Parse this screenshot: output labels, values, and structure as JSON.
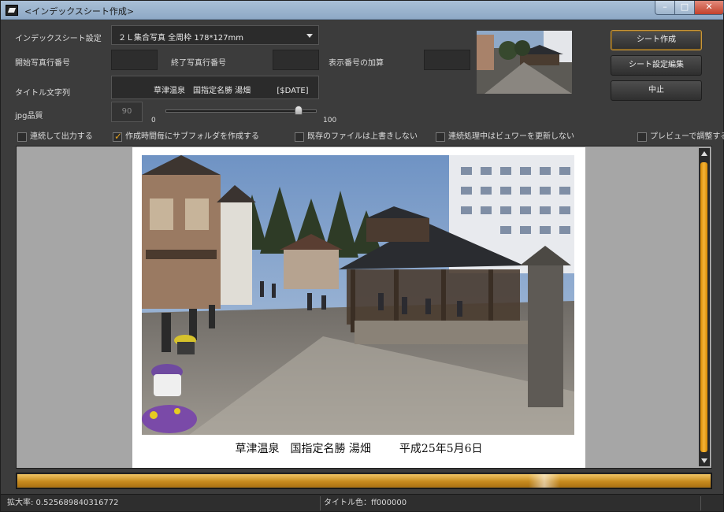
{
  "window": {
    "title": "<インデックスシート作成>",
    "controls": {
      "minimize": "–",
      "maximize": "□",
      "close": "✕"
    }
  },
  "settings": {
    "sheet_setting_label": "インデックスシート設定",
    "sheet_setting_value": "２Ｌ集合写真 全周枠 178*127mm",
    "start_row_label": "開始写真行番号",
    "start_row_value": "",
    "end_row_label": "終了写真行番号",
    "end_row_value": "",
    "display_offset_label": "表示番号の加算",
    "display_offset_value": "",
    "title_label": "タイトル文字列",
    "title_value": "草津温泉　国指定名勝 湯畑　　　 [$DATE]",
    "jpg_quality_label": "jpg品質",
    "jpg_quality_value": "90",
    "slider_min": "0",
    "slider_max": "100",
    "slider_level_percent": 90
  },
  "buttons": {
    "create_sheet": "シート作成",
    "edit_sheet_settings": "シート設定編集",
    "cancel": "中止"
  },
  "checkboxes": [
    {
      "label": "連続して出力する",
      "checked": false
    },
    {
      "label": "作成時間毎にサブフォルダを作成する",
      "checked": true
    },
    {
      "label": "既存のファイルは上書きしない",
      "checked": false
    },
    {
      "label": "連続処理中はビュワーを更新しない",
      "checked": false
    },
    {
      "label": "プレビューで調整する",
      "checked": false
    }
  ],
  "preview": {
    "caption_title": "草津温泉　国指定名勝 湯畑",
    "caption_date": "平成25年5月6日"
  },
  "progress": {
    "level_percent": 100
  },
  "statusbar": {
    "zoom": "拡大率: 0.525689840316772",
    "title_color": "タイトル色：ff000000"
  },
  "colors": {
    "accent": "#e0a020",
    "background": "#3c3c3c"
  }
}
